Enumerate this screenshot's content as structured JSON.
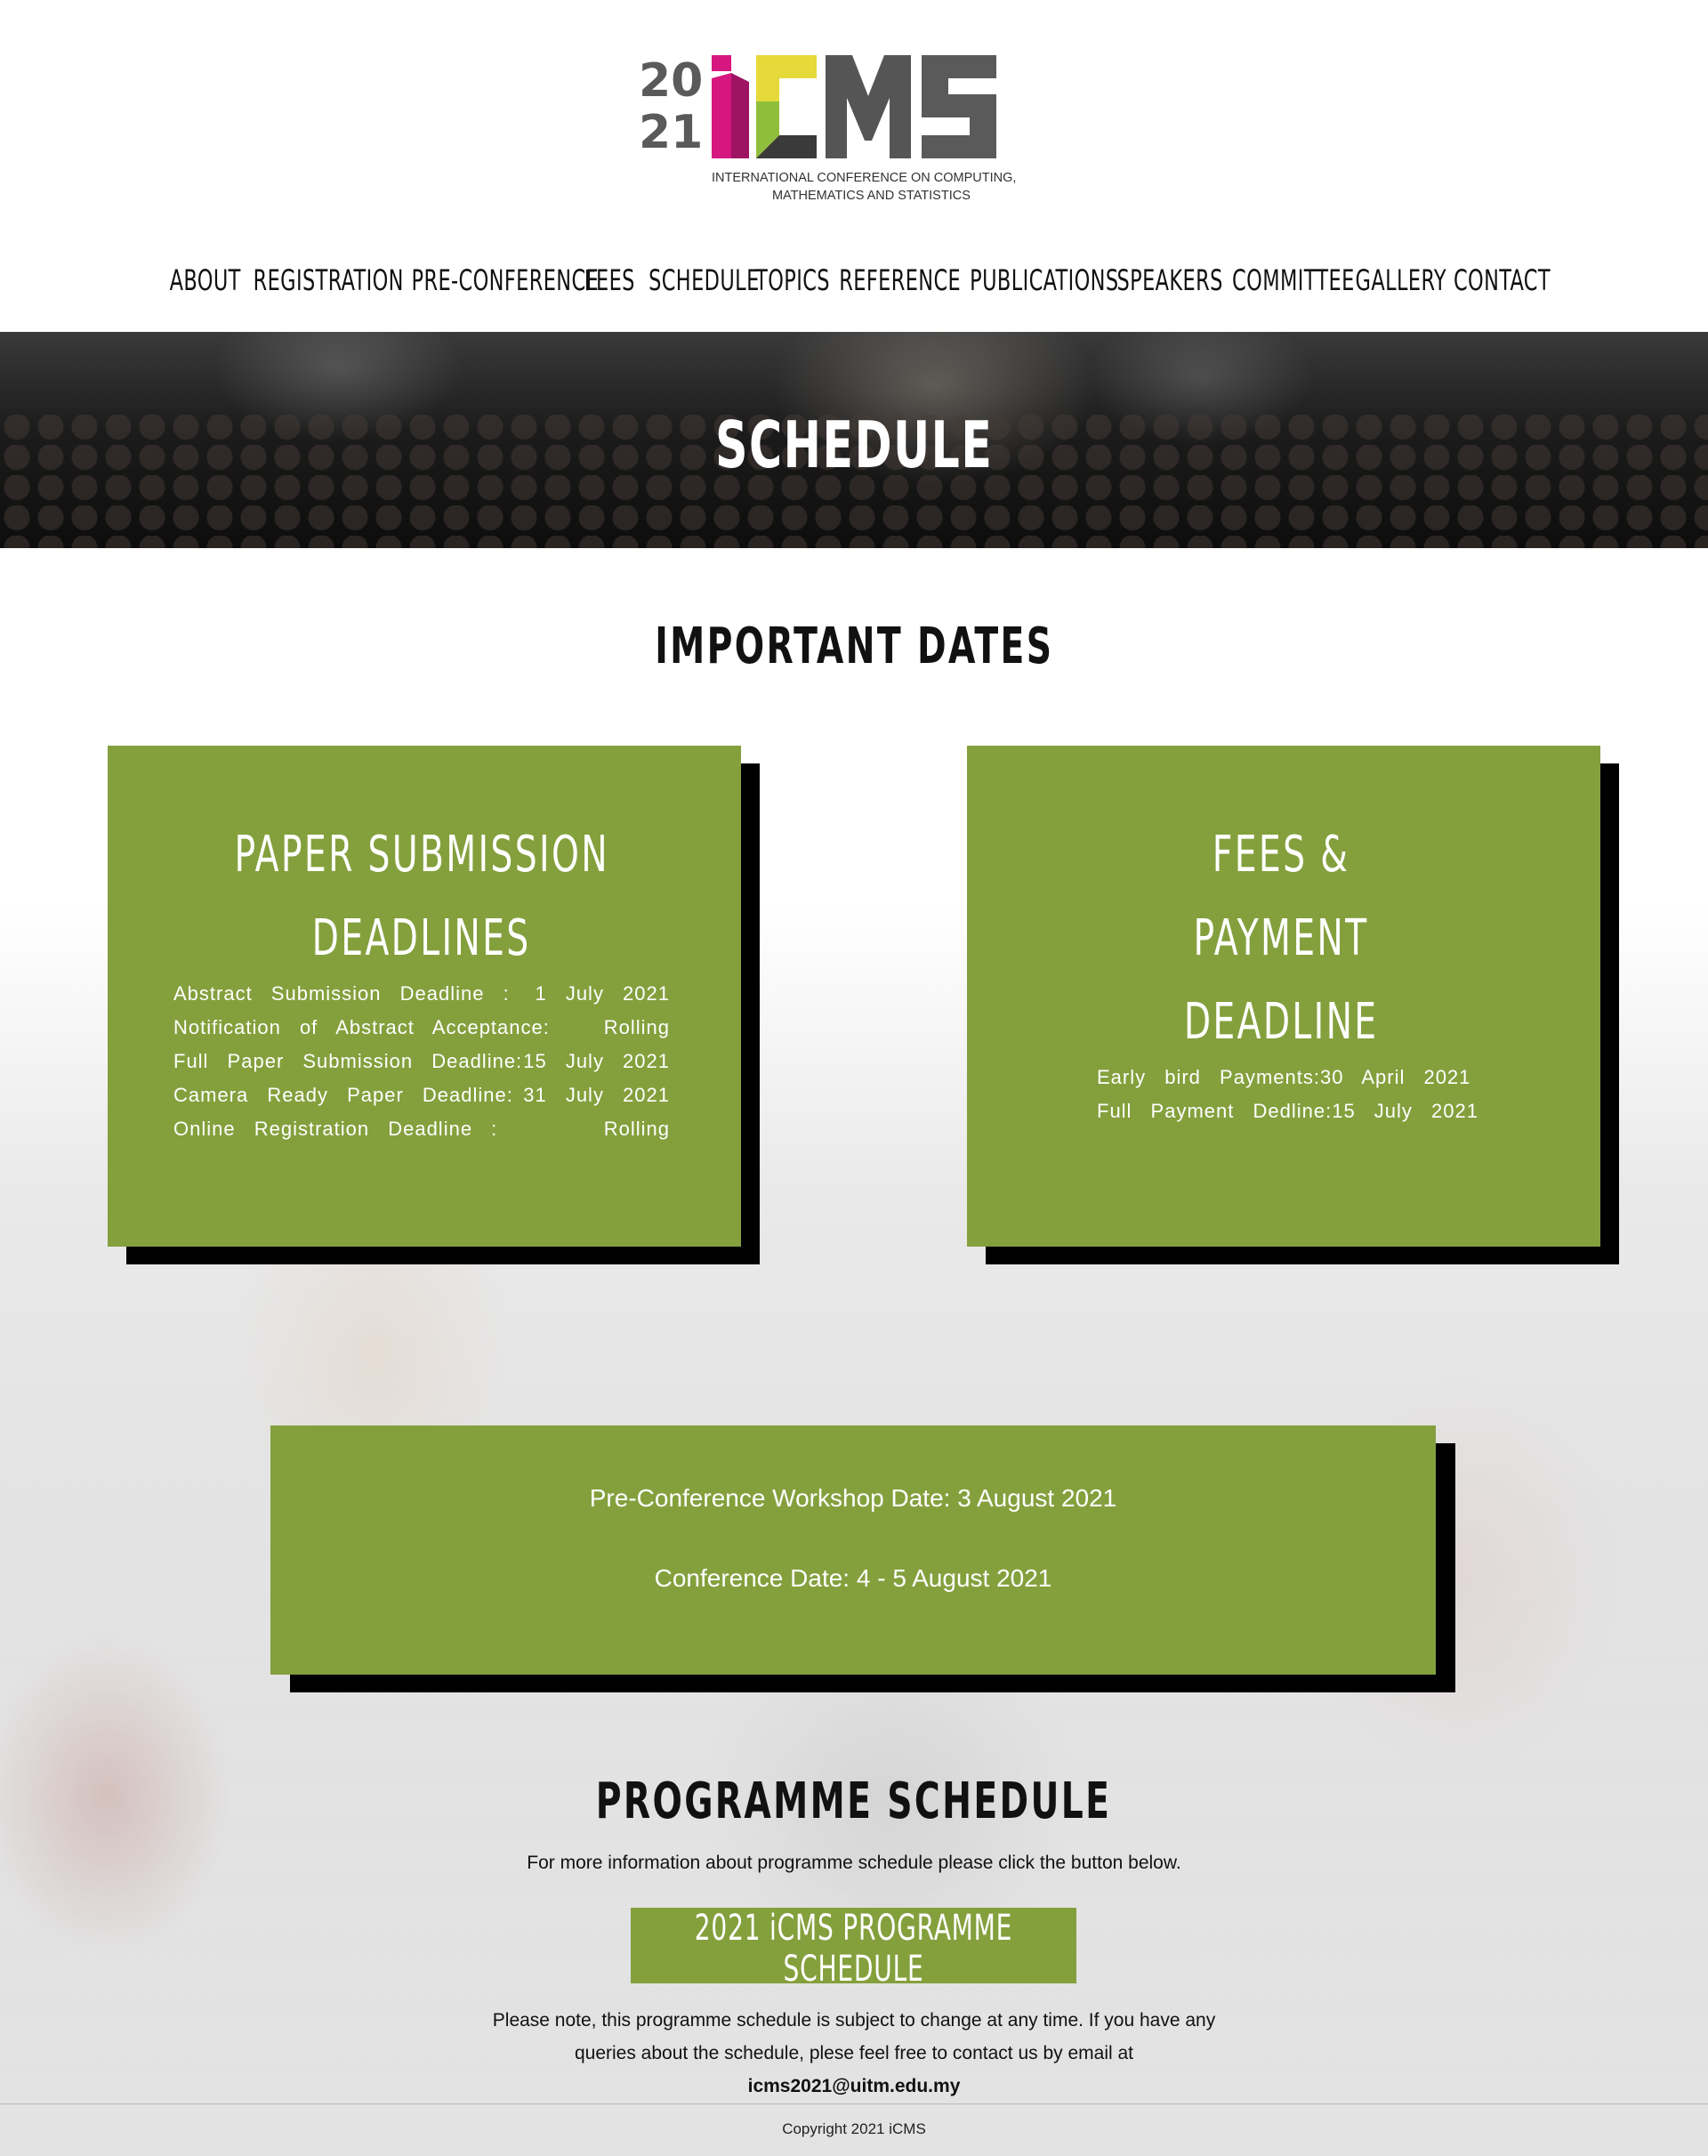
{
  "logo": {
    "year_top": "20",
    "year_bottom": "21",
    "acronym": "iCMS",
    "tagline_line1": "INTERNATIONAL CONFERENCE ON COMPUTING,",
    "tagline_line2": "MATHEMATICS AND STATISTICS"
  },
  "nav": {
    "items": [
      "ABOUT",
      "REGISTRATION",
      "PRE-CONFERENCE",
      "FEES",
      "SCHEDULE",
      "TOPICS",
      "REFERENCE",
      "PUBLICATIONS",
      "SPEAKERS",
      "COMMITTEE",
      "GALLERY",
      "CONTACT"
    ]
  },
  "hero": {
    "title": "SCHEDULE"
  },
  "important_dates": {
    "heading": "IMPORTANT DATES",
    "paper_card": {
      "title_line1": "PAPER SUBMISSION",
      "title_line2": "DEADLINES",
      "rows": [
        {
          "label": "Abstract Submission Deadline :",
          "value": "1 July 2021"
        },
        {
          "label": "Notification of Abstract Acceptance:",
          "value": "Rolling"
        },
        {
          "label": "Full Paper Submission Deadline:",
          "value": "15 July 2021"
        },
        {
          "label": "Camera Ready Paper Deadline:",
          "value": "31 July 2021"
        },
        {
          "label": "Online Registration Deadline :",
          "value": "Rolling"
        }
      ]
    },
    "fees_card": {
      "title_line1": "FEES & PAYMENT",
      "title_line2": "DEADLINE",
      "rows": [
        {
          "label": "Early bird Payments:",
          "value": "30 April 2021"
        },
        {
          "label": "Full Payment Dedline:",
          "value": "15 July 2021"
        }
      ]
    },
    "conference_card": {
      "workshop": "Pre-Conference Workshop Date: 3 August 2021",
      "conference": "Conference Date: 4 - 5 August 2021"
    }
  },
  "programme": {
    "heading": "PROGRAMME SCHEDULE",
    "intro": "For more information about programme schedule please click the button below.",
    "button_label": "2021 iCMS PROGRAMME SCHEDULE",
    "note_line1": "Please note, this programme schedule is subject to change at any time. If you have any",
    "note_line2": "queries about the schedule, plese feel free to contact us by email at",
    "email": "icms2021@uitm.edu.my"
  },
  "footer": {
    "copyright": "Copyright 2021 iCMS"
  },
  "colors": {
    "accent_green": "#84a03d",
    "shadow": "#000000",
    "logo_pink": "#d6177f",
    "logo_yellow": "#e6d93a",
    "logo_grey": "#5a5a5a"
  }
}
